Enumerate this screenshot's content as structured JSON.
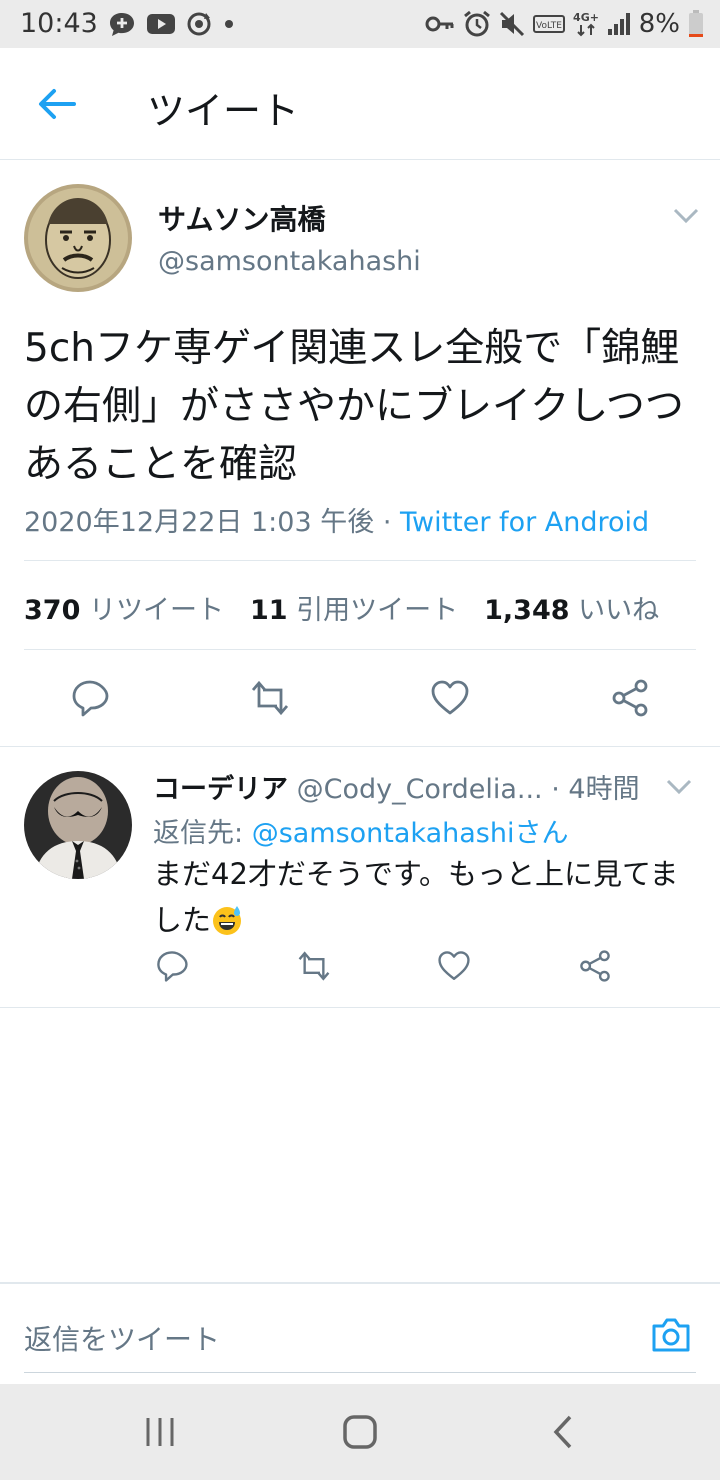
{
  "status_bar": {
    "time": "10:43",
    "battery_percent": "8%",
    "network_label": "4G+",
    "volte_label": "VoLTE",
    "left_icons": [
      "chat-plus-icon",
      "youtube-icon",
      "sync-icon",
      "dot-icon"
    ],
    "right_icons": [
      "key-icon",
      "alarm-icon",
      "mute-icon",
      "volte-icon",
      "network-4g-icon",
      "signal-icon",
      "battery-icon"
    ]
  },
  "app_bar": {
    "title": "ツイート"
  },
  "tweet": {
    "author_name": "サムソン高橋",
    "author_handle": "@samsontakahashi",
    "text": "5chフケ専ゲイ関連スレ全般で「錦鯉の右側」がささやかにブレイクしつつあることを確認",
    "timestamp": "2020年12月22日 1:03 午後",
    "separator": " · ",
    "source": "Twitter for Android",
    "stats": {
      "retweets_count": "370",
      "retweets_label": "リツイート",
      "quotes_count": "11",
      "quotes_label": "引用ツイート",
      "likes_count": "1,348",
      "likes_label": "いいね"
    },
    "actions": [
      "reply-icon",
      "retweet-icon",
      "like-icon",
      "share-icon"
    ]
  },
  "reply": {
    "author_name": "コーデリア",
    "author_handle": "@Cody_Cordelia...",
    "time": "· 4時間",
    "reply_to_prefix": "返信先: ",
    "reply_to_mention": "@samsontakahashiさん",
    "text": "まだ42才だそうです。もっと上に見てました",
    "emoji": "grinning-face-with-sweat-emoji"
  },
  "composer": {
    "placeholder": "返信をツイート"
  },
  "accent_color": "#1da1f2",
  "secondary_text_color": "#657786",
  "nav_bar": [
    "recent-apps-icon",
    "home-icon",
    "back-icon"
  ]
}
